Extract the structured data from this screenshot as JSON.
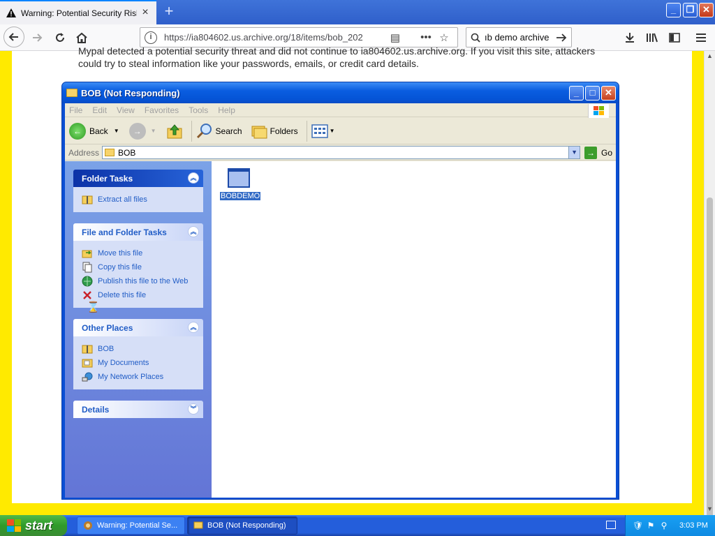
{
  "browser": {
    "tab_title": "Warning: Potential Security Risk A",
    "url": "https://ia804602.us.archive.org/18/items/bob_202",
    "search_text": "ıb demo archive"
  },
  "page": {
    "warning_text": "Mypal detected a potential security threat and did not continue to ia804602.us.archive.org. If you visit this site, attackers could try to steal information like your passwords, emails, or credit card details."
  },
  "explorer": {
    "title": "BOB (Not Responding)",
    "menu": [
      "File",
      "Edit",
      "View",
      "Favorites",
      "Tools",
      "Help"
    ],
    "toolbar": {
      "back": "Back",
      "search": "Search",
      "folders": "Folders"
    },
    "address_label": "Address",
    "address_value": "BOB",
    "go_label": "Go",
    "panels": {
      "folder_tasks": {
        "title": "Folder Tasks",
        "items": [
          "Extract all files"
        ]
      },
      "file_tasks": {
        "title": "File and Folder Tasks",
        "items": [
          "Move this file",
          "Copy this file",
          "Publish this file to the Web",
          "Delete this file"
        ]
      },
      "other_places": {
        "title": "Other Places",
        "items": [
          "BOB",
          "My Documents",
          "My Network Places"
        ]
      },
      "details": {
        "title": "Details"
      }
    },
    "files": [
      {
        "name": "BOBDEMO",
        "selected": true
      }
    ]
  },
  "taskbar": {
    "start_label": "start",
    "items": [
      "Warning: Potential Se...",
      "BOB (Not Responding)"
    ],
    "clock": "3:03 PM"
  },
  "colors": {
    "page_border": "#ffea00",
    "xp_title": "#0554d6",
    "start_green": "#3a9a32"
  }
}
